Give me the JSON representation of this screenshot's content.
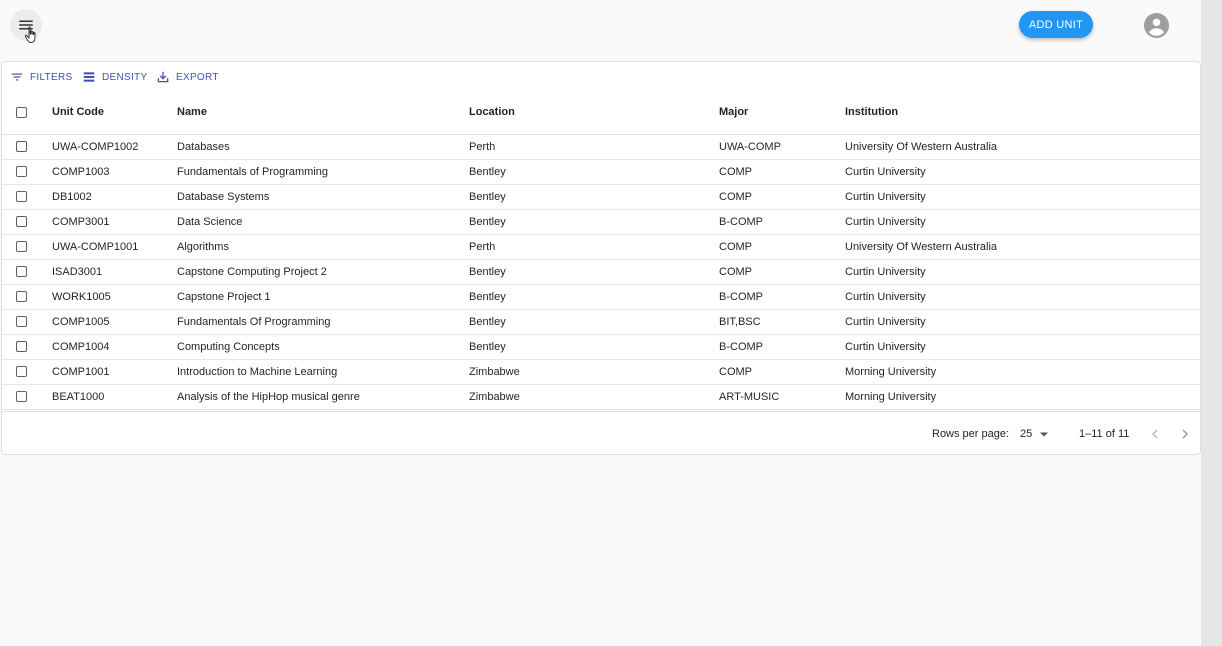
{
  "header": {
    "add_button_label": "ADD UNIT"
  },
  "toolbar": {
    "filters_label": "FILTERS",
    "density_label": "DENSITY",
    "export_label": "EXPORT"
  },
  "table": {
    "columns": [
      "Unit Code",
      "Name",
      "Location",
      "Major",
      "Institution"
    ],
    "rows": [
      [
        "UWA-COMP1002",
        "Databases",
        "Perth",
        "UWA-COMP",
        "University Of Western Australia"
      ],
      [
        "COMP1003",
        "Fundamentals of Programming",
        "Bentley",
        "COMP",
        "Curtin University"
      ],
      [
        "DB1002",
        "Database Systems",
        "Bentley",
        "COMP",
        "Curtin University"
      ],
      [
        "COMP3001",
        "Data Science",
        "Bentley",
        "B-COMP",
        "Curtin University"
      ],
      [
        "UWA-COMP1001",
        "Algorithms",
        "Perth",
        "COMP",
        "University Of Western Australia"
      ],
      [
        "ISAD3001",
        "Capstone Computing Project 2",
        "Bentley",
        "COMP",
        "Curtin University"
      ],
      [
        "WORK1005",
        "Capstone Project 1",
        "Bentley",
        "B-COMP",
        "Curtin University"
      ],
      [
        "COMP1005",
        "Fundamentals Of Programming",
        "Bentley",
        "BIT,BSC",
        "Curtin University"
      ],
      [
        "COMP1004",
        "Computing Concepts",
        "Bentley",
        "B-COMP",
        "Curtin University"
      ],
      [
        "COMP1001",
        "Introduction to Machine Learning",
        "Zimbabwe",
        "COMP",
        "Morning University"
      ],
      [
        "BEAT1000",
        "Analysis of the HipHop musical genre",
        "Zimbabwe",
        "ART-MUSIC",
        "Morning University"
      ]
    ]
  },
  "pagination": {
    "rows_per_page_label": "Rows per page:",
    "rows_per_page_value": "25",
    "range_text": "1–11 of 11"
  },
  "colors": {
    "primary": "#2196f3",
    "toolbar_accent": "#3f51b5"
  },
  "icons": [
    "menu-icon",
    "account-circle-icon",
    "filter-icon",
    "density-icon",
    "export-icon",
    "dropdown-arrow-icon",
    "chevron-left-icon",
    "chevron-right-icon"
  ]
}
